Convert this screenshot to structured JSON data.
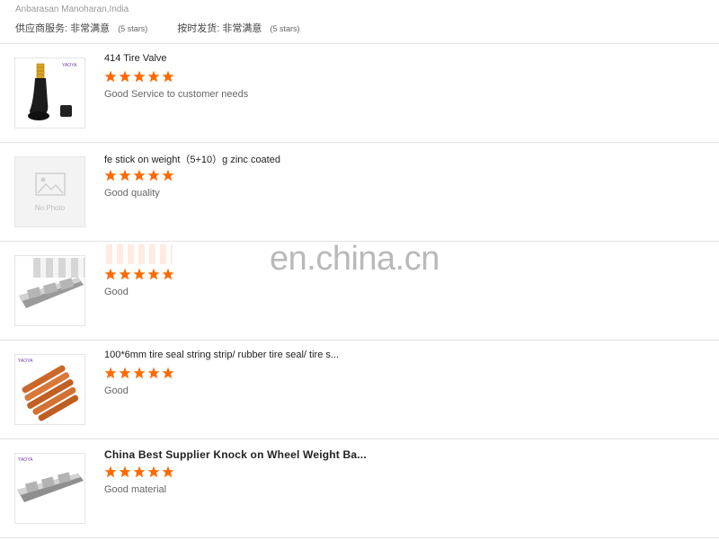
{
  "header": {
    "reviewer": "Anbarasan Manoharan,India",
    "ratings": [
      {
        "label": "供应商服务:",
        "value": "非常满意",
        "stars": "(5 stars)"
      },
      {
        "label": "按时发货:",
        "value": "非常满意",
        "stars": "(5 stars)"
      }
    ]
  },
  "reviews": [
    {
      "title": "414 Tire Valve",
      "rating": 5,
      "comment": "Good Service to customer needs",
      "image": "tire-valve"
    },
    {
      "title": "fe stick on weight（5+10）g zinc coated",
      "rating": 5,
      "comment": "Good quality",
      "image": "no-photo",
      "no_photo_text": "No Photo"
    },
    {
      "title": "",
      "rating": 5,
      "comment": "Good",
      "image": "wheel-weight-blurred"
    },
    {
      "title": "100*6mm tire seal string strip/ rubber tire seal/ tire s...",
      "rating": 5,
      "comment": "Good",
      "image": "tire-seal-strips"
    },
    {
      "title": "China Best Supplier Knock on Wheel Weight Ba...",
      "rating": 5,
      "comment": "Good material",
      "image": "wheel-weight"
    }
  ],
  "brand_tag": "YAOYA",
  "watermark": "en.china.cn",
  "colors": {
    "star": "#ff6a00",
    "divider": "#e3e3e3",
    "brand": "#7a3fa8"
  }
}
